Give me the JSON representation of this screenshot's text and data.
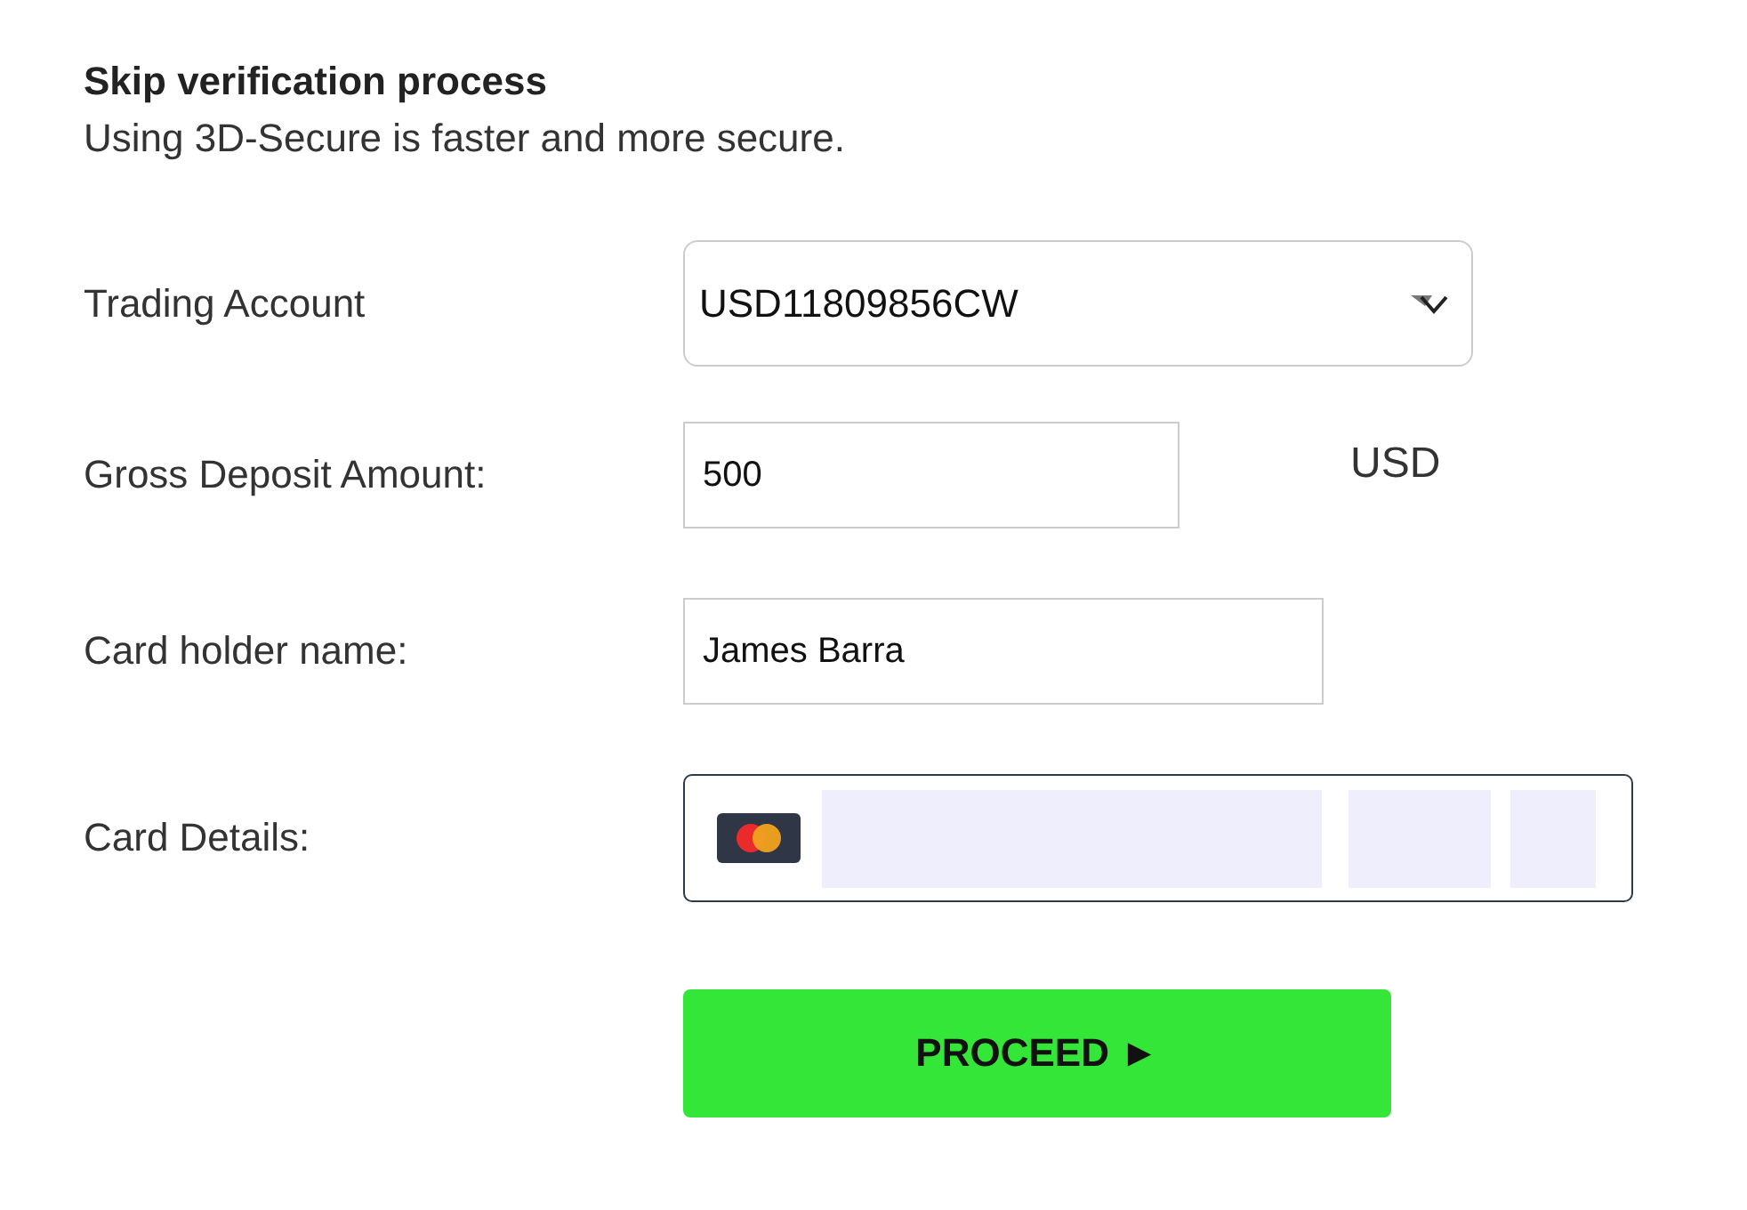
{
  "heading": {
    "title": "Skip verification process",
    "subtitle": "Using 3D-Secure is faster and more secure."
  },
  "fields": [
    {
      "kind": "select",
      "label": "Trading Account",
      "value": "USD11809856CW"
    },
    {
      "kind": "amount",
      "label": "Gross Deposit Amount:",
      "value": "500",
      "unit": "USD"
    },
    {
      "kind": "text",
      "label": "Card holder name:",
      "value": "James Barra"
    },
    {
      "kind": "card",
      "label": "Card Details:"
    }
  ],
  "button": {
    "label": "PROCEED ►"
  }
}
